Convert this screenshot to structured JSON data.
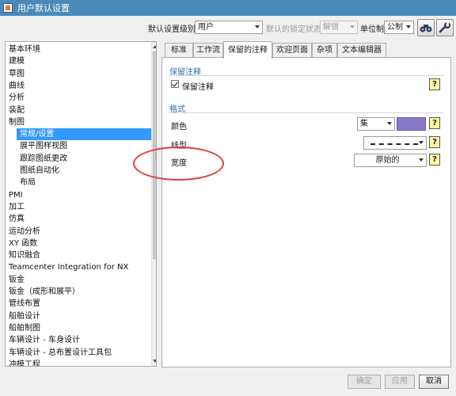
{
  "window": {
    "title": "用户默认设置"
  },
  "toolbar": {
    "level_label": "默认设置级别",
    "level_value": "用户",
    "lock_label": "默认的锁定状态",
    "lock_value": "解锁",
    "unit_label": "单位制",
    "unit_value": "公制"
  },
  "tree": {
    "items": [
      {
        "label": "基本环境",
        "indent": 0,
        "selected": false
      },
      {
        "label": "建模",
        "indent": 0,
        "selected": false
      },
      {
        "label": "草图",
        "indent": 0,
        "selected": false
      },
      {
        "label": "曲线",
        "indent": 0,
        "selected": false
      },
      {
        "label": "分析",
        "indent": 0,
        "selected": false
      },
      {
        "label": "装配",
        "indent": 0,
        "selected": false
      },
      {
        "label": "制图",
        "indent": 0,
        "selected": false
      },
      {
        "label": "常规/设置",
        "indent": 1,
        "selected": true
      },
      {
        "label": "展平图样视图",
        "indent": 1,
        "selected": false
      },
      {
        "label": "跟踪图纸更改",
        "indent": 1,
        "selected": false
      },
      {
        "label": "图纸自动化",
        "indent": 1,
        "selected": false
      },
      {
        "label": "布局",
        "indent": 1,
        "selected": false
      },
      {
        "label": "PMI",
        "indent": 0,
        "selected": false
      },
      {
        "label": "加工",
        "indent": 0,
        "selected": false
      },
      {
        "label": "仿真",
        "indent": 0,
        "selected": false
      },
      {
        "label": "运动分析",
        "indent": 0,
        "selected": false
      },
      {
        "label": "XY 函数",
        "indent": 0,
        "selected": false
      },
      {
        "label": "知识融合",
        "indent": 0,
        "selected": false
      },
      {
        "label": "Teamcenter Integration for NX",
        "indent": 0,
        "selected": false
      },
      {
        "label": "钣金",
        "indent": 0,
        "selected": false
      },
      {
        "label": "钣金（成形和展平）",
        "indent": 0,
        "selected": false
      },
      {
        "label": "管线布置",
        "indent": 0,
        "selected": false
      },
      {
        "label": "船舶设计",
        "indent": 0,
        "selected": false
      },
      {
        "label": "船舶制图",
        "indent": 0,
        "selected": false
      },
      {
        "label": "车辆设计 - 车身设计",
        "indent": 0,
        "selected": false
      },
      {
        "label": "车辆设计 - 总布置设计工具包",
        "indent": 0,
        "selected": false
      },
      {
        "label": "冲模工程",
        "indent": 0,
        "selected": false
      }
    ]
  },
  "tabs": [
    {
      "label": "标准",
      "active": false
    },
    {
      "label": "工作流",
      "active": false
    },
    {
      "label": "保留的注释",
      "active": true
    },
    {
      "label": "欢迎页面",
      "active": false
    },
    {
      "label": "杂项",
      "active": false
    },
    {
      "label": "文本编辑器",
      "active": false
    }
  ],
  "content": {
    "retain_section_title": "保留注释",
    "retain_checkbox_label": "保留注释",
    "retain_checked": true,
    "format_section_title": "格式",
    "color_label": "颜色",
    "color_combo_value": "集",
    "color_swatch": "#8878c8",
    "linetype_label": "线型",
    "width_label": "宽度",
    "width_value": "原始的",
    "help_glyph": "?"
  },
  "annotation": {
    "color": "#e04040"
  },
  "buttons": {
    "ok": "确定",
    "apply": "应用",
    "cancel": "取消"
  }
}
